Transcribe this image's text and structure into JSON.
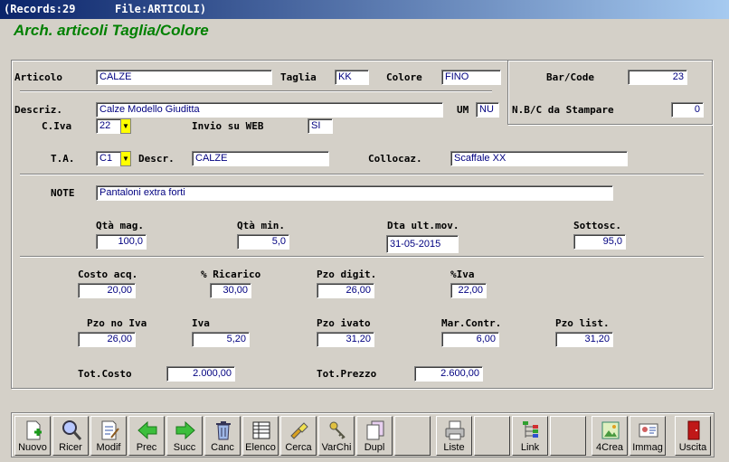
{
  "window": {
    "records": "(Records:29",
    "file": "File:ARTICOLI)"
  },
  "app_title": "Arch. articoli Taglia/Colore",
  "labels": {
    "articolo": "Articolo",
    "taglia": "Taglia",
    "colore": "Colore",
    "barcode": "Bar/Code",
    "nbc": "N.B/C da Stampare",
    "descriz": "Descriz.",
    "um": "UM",
    "civa": "C.Iva",
    "invio": "Invio su WEB",
    "ta": "T.A.",
    "descr": "Descr.",
    "collocaz": "Collocaz.",
    "note": "NOTE",
    "qta_mag": "Qtà mag.",
    "qta_min": "Qtà min.",
    "dta": "Dta ult.mov.",
    "sottosc": "Sottosc.",
    "costo_acq": "Costo acq.",
    "ricarico": "% Ricarico",
    "pzo_digit": "Pzo digit.",
    "piva": "%Iva",
    "pzo_no_iva": "Pzo no Iva",
    "iva": "Iva",
    "pzo_ivato": "Pzo ivato",
    "mar_contr": "Mar.Contr.",
    "pzo_list": "Pzo list.",
    "tot_costo": "Tot.Costo",
    "tot_prezzo": "Tot.Prezzo"
  },
  "values": {
    "articolo": "CALZE",
    "taglia": "KK",
    "colore": "FINO",
    "barcode": "23",
    "nbc": "0",
    "descriz": "Calze Modello Giuditta",
    "um": "NU",
    "civa": "22",
    "invio": "SI",
    "ta": "C1",
    "descr": "CALZE",
    "collocaz": "Scaffale XX",
    "note": "Pantaloni extra forti",
    "qta_mag": "100,0",
    "qta_min": "5,0",
    "dta": "31-05-2015",
    "sottosc": "95,0",
    "costo_acq": "20,00",
    "ricarico": "30,00",
    "pzo_digit": "26,00",
    "piva": "22,00",
    "pzo_no_iva": "26,00",
    "iva": "5,20",
    "pzo_ivato": "31,20",
    "mar_contr": "6,00",
    "pzo_list": "31,20",
    "tot_costo": "2.000,00",
    "tot_prezzo": "2.600,00"
  },
  "toolbar": [
    {
      "label": "Nuovo",
      "icon": "new-document-icon"
    },
    {
      "label": "Ricer",
      "icon": "magnifier-icon"
    },
    {
      "label": "Modif",
      "icon": "edit-document-icon"
    },
    {
      "label": "Prec",
      "icon": "arrow-left-icon"
    },
    {
      "label": "Succ",
      "icon": "arrow-right-icon"
    },
    {
      "label": "Canc",
      "icon": "trash-icon"
    },
    {
      "label": "Elenco",
      "icon": "table-icon"
    },
    {
      "label": "Cerca",
      "icon": "flashlight-icon"
    },
    {
      "label": "VarChi",
      "icon": "keys-icon"
    },
    {
      "label": "Dupl",
      "icon": "copy-icon"
    },
    {
      "label": "Liste",
      "icon": "printer-icon"
    },
    {
      "label": "Link",
      "icon": "tree-icon"
    },
    {
      "label": "4Crea",
      "icon": "image-create-icon"
    },
    {
      "label": "Immag",
      "icon": "id-card-icon"
    },
    {
      "label": "Uscita",
      "icon": "exit-door-icon"
    }
  ]
}
